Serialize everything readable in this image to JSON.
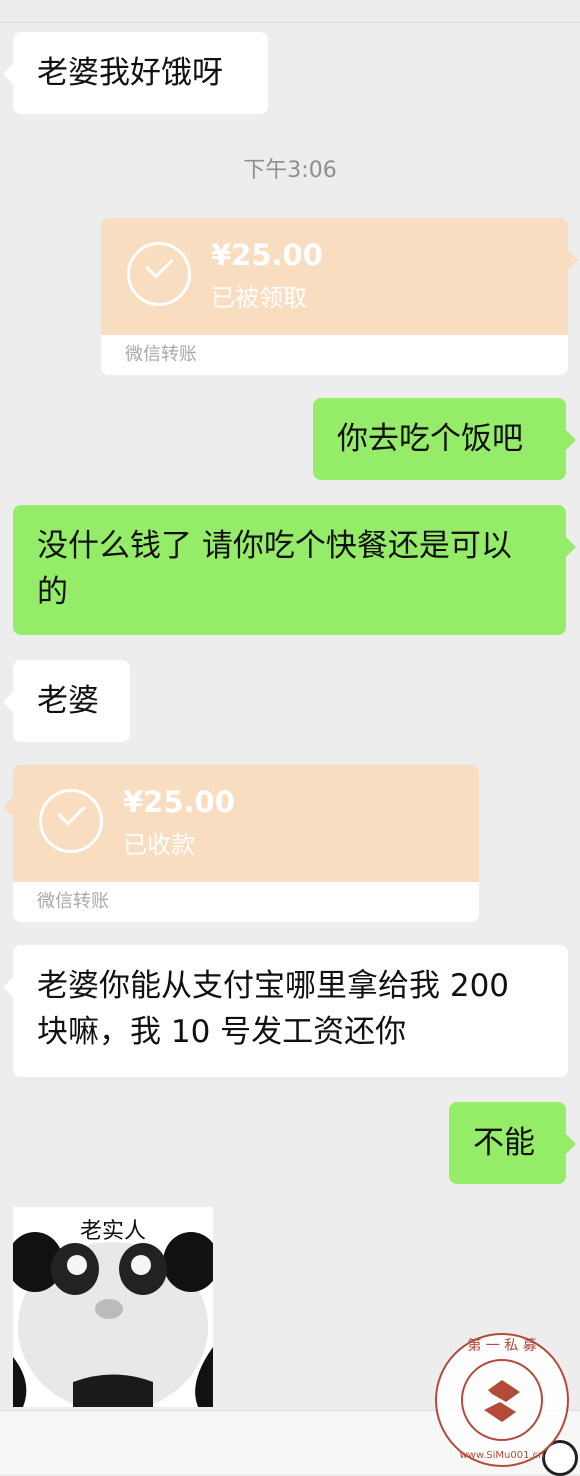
{
  "messages": {
    "m1": "老婆我好饿呀",
    "timestamp": "下午3:06",
    "t1": {
      "amount": "¥25.00",
      "status": "已被领取",
      "label": "微信转账"
    },
    "m2": "你去吃个饭吧",
    "m3": "没什么钱了 请你吃个快餐还是可以的",
    "m4": "老婆",
    "t2": {
      "amount": "¥25.00",
      "status": "已收款",
      "label": "微信转账"
    },
    "m5": "老婆你能从支付宝哪里拿给我 200 块嘛，我 10 号发工资还你",
    "m6": "不能",
    "sticker_caption": "老实人"
  },
  "watermark": {
    "text": "第一私募",
    "url": "www.SiMu001.cn"
  },
  "colors": {
    "bg": "#ededed",
    "sent": "#95ec69",
    "received": "#ffffff",
    "transfer": "#f9ddc0"
  },
  "icons": [
    "check-circle-icon",
    "emoji-icon",
    "panda-sticker"
  ]
}
